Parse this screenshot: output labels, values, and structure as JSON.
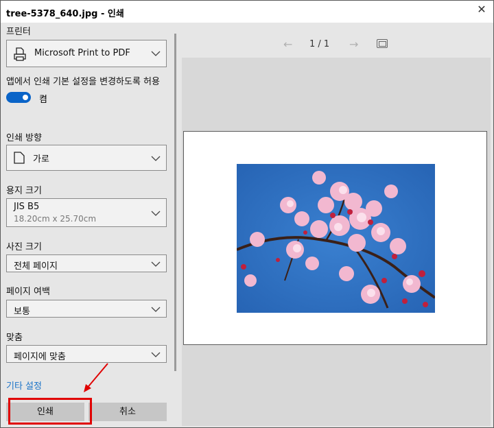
{
  "window": {
    "title": "tree-5378_640.jpg - 인쇄"
  },
  "printer": {
    "label": "프린터",
    "value": "Microsoft Print to PDF"
  },
  "app_settings": {
    "label": "앱에서 인쇄 기본 설정을 변경하도록 허용",
    "toggle_state": "켬",
    "accent": "#0a64c8"
  },
  "orientation": {
    "label": "인쇄 방향",
    "value": "가로"
  },
  "paper_size": {
    "label": "용지 크기",
    "value": "JIS B5",
    "sub": "18.20cm x 25.70cm"
  },
  "photo_size": {
    "label": "사진 크기",
    "value": "전체 페이지"
  },
  "margins": {
    "label": "페이지 여백",
    "value": "보통"
  },
  "fit": {
    "label": "맞춤",
    "value": "페이지에 맞춤"
  },
  "more_settings": {
    "label": "기타 설정",
    "color": "#1a73c8"
  },
  "buttons": {
    "print": "인쇄",
    "cancel": "취소"
  },
  "preview": {
    "page_indicator": "1 / 1"
  },
  "icons": {
    "close": "close-icon",
    "printer": "printer-icon",
    "page": "page-orientation-icon",
    "prev": "arrow-left-icon",
    "next": "arrow-right-icon",
    "fit": "fit-page-icon"
  },
  "annotation": {
    "highlight_color": "#e00000"
  }
}
